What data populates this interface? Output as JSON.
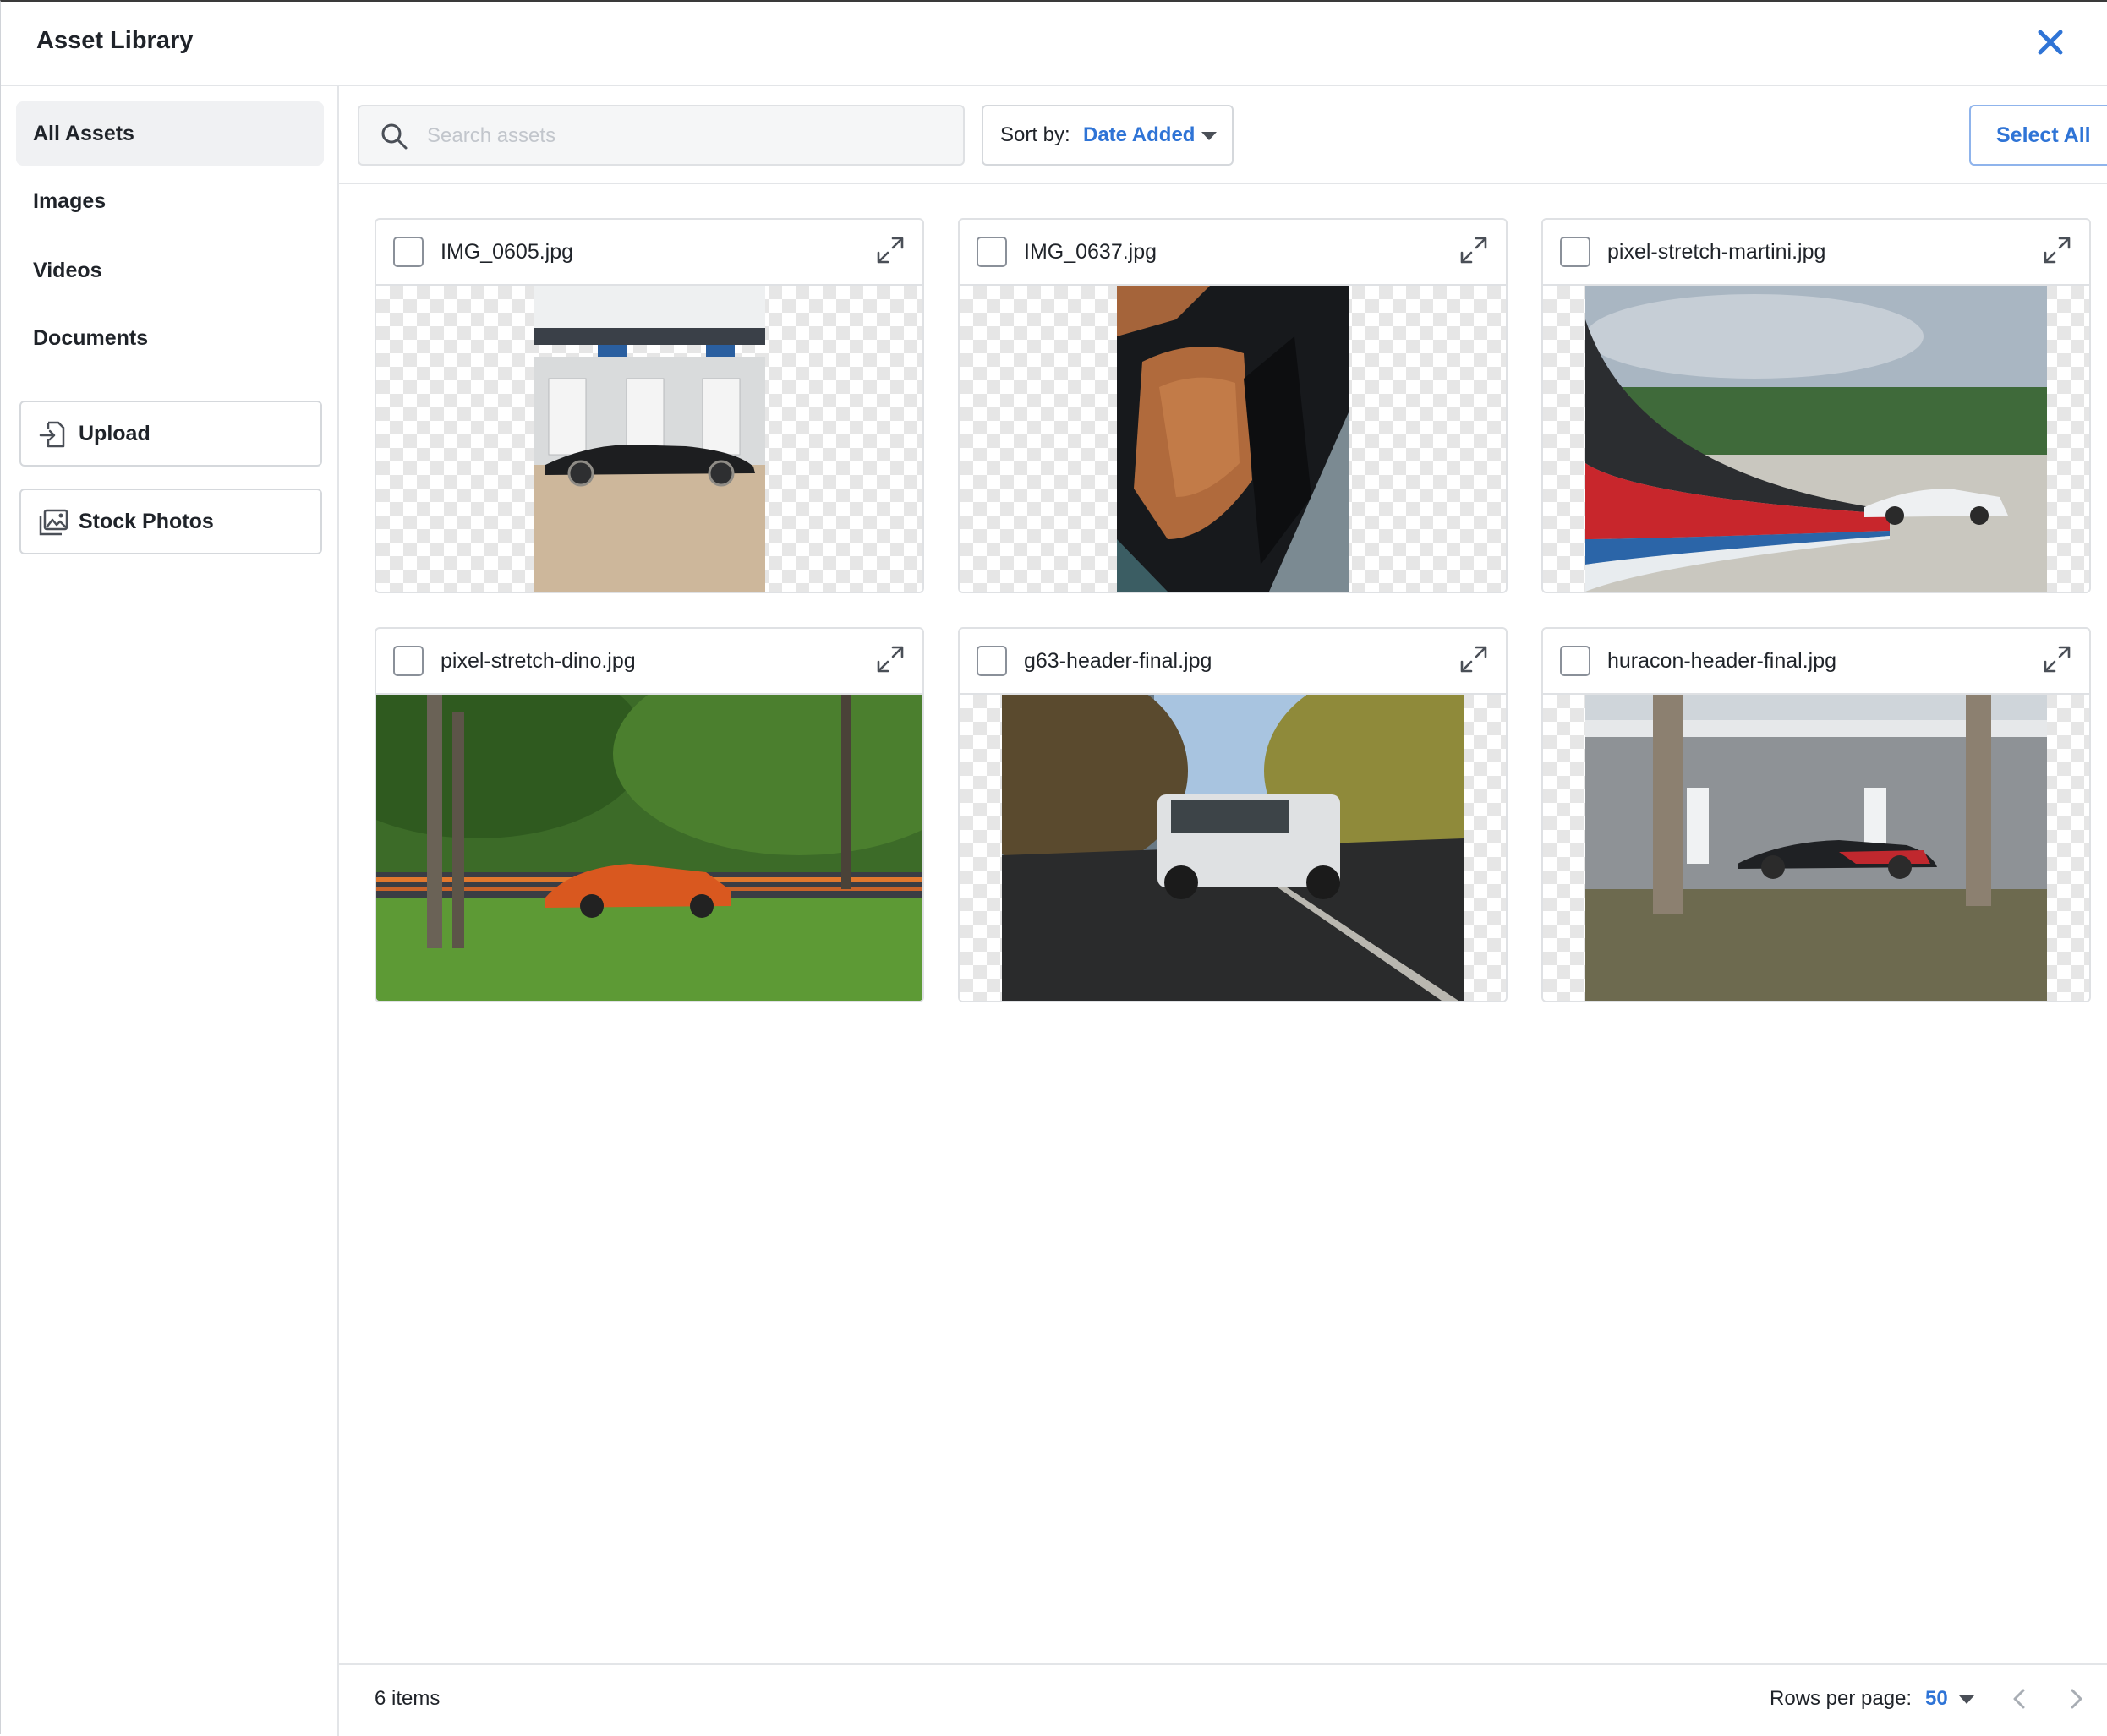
{
  "header": {
    "title": "Asset Library"
  },
  "sidebar": {
    "items": [
      {
        "label": "All Assets"
      },
      {
        "label": "Images"
      },
      {
        "label": "Videos"
      },
      {
        "label": "Documents"
      }
    ],
    "upload_label": "Upload",
    "stock_label": "Stock Photos"
  },
  "toolbar": {
    "search_placeholder": "Search assets",
    "sort_label": "Sort by:",
    "sort_value": "Date Added",
    "select_all_label": "Select All"
  },
  "assets": [
    {
      "name": "IMG_0605.jpg"
    },
    {
      "name": "IMG_0637.jpg"
    },
    {
      "name": "pixel-stretch-martini.jpg"
    },
    {
      "name": "pixel-stretch-dino.jpg"
    },
    {
      "name": "g63-header-final.jpg"
    },
    {
      "name": "huracon-header-final.jpg"
    }
  ],
  "footer": {
    "item_count": "6 items",
    "rows_per_page_label": "Rows per page:",
    "rows_per_page_value": "50"
  },
  "colors": {
    "accent": "#2f74d6",
    "border": "#dfe1e4",
    "active_nav": "#f0f1f3"
  }
}
